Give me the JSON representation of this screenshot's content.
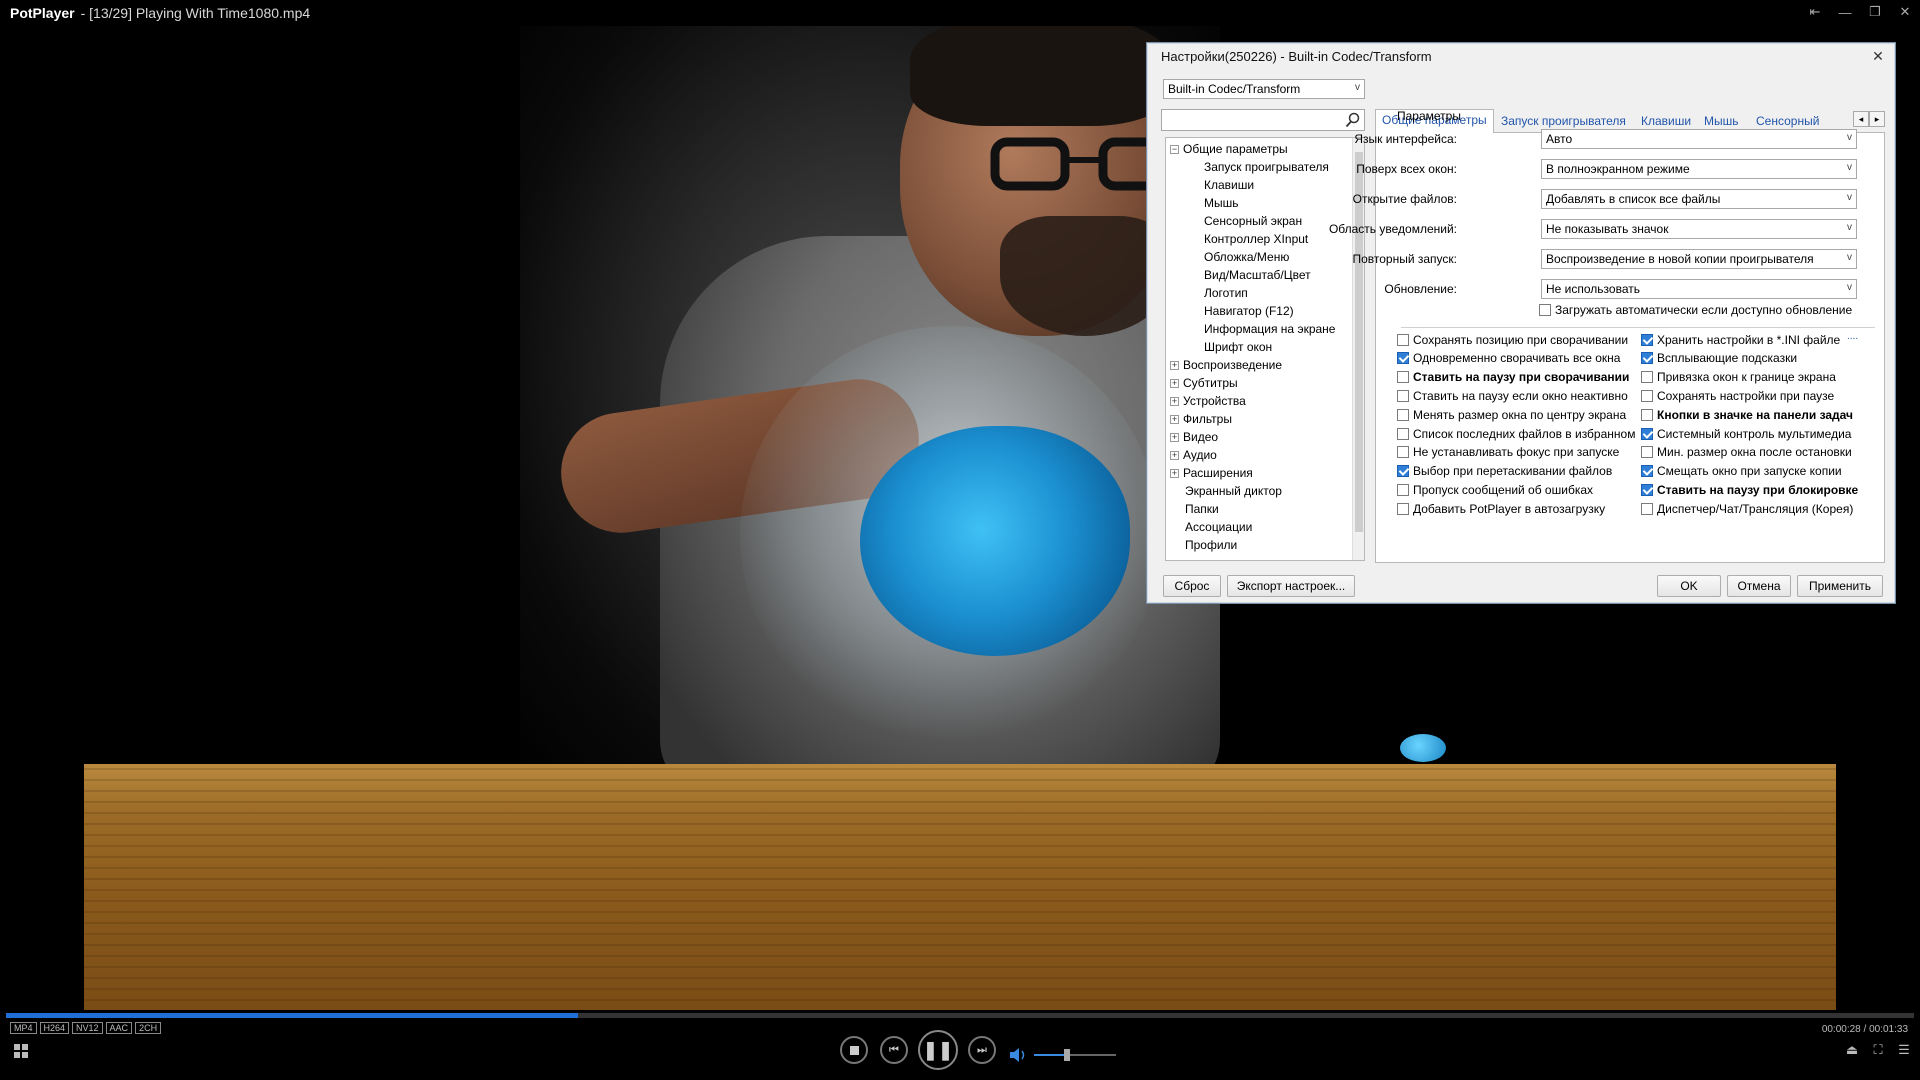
{
  "window": {
    "brand": "PotPlayer",
    "title": " - [13/29] Playing With Time1080.mp4"
  },
  "dialog": {
    "title": "Настройки(250226) - Built-in Codec/Transform",
    "profile_combo": "Built-in Codec/Transform",
    "search_placeholder": "",
    "tree": [
      {
        "label": "Общие параметры",
        "level": 0,
        "expander": "−"
      },
      {
        "label": "Запуск проигрывателя",
        "level": 1
      },
      {
        "label": "Клавиши",
        "level": 1
      },
      {
        "label": "Мышь",
        "level": 1
      },
      {
        "label": "Сенсорный экран",
        "level": 1
      },
      {
        "label": "Контроллер XInput",
        "level": 1
      },
      {
        "label": "Обложка/Меню",
        "level": 1
      },
      {
        "label": "Вид/Масштаб/Цвет",
        "level": 1
      },
      {
        "label": "Логотип",
        "level": 1
      },
      {
        "label": "Навигатор (F12)",
        "level": 1
      },
      {
        "label": "Информация на экране",
        "level": 1
      },
      {
        "label": "Шрифт окон",
        "level": 1
      },
      {
        "label": "Воспроизведение",
        "level": 0,
        "expander": "+"
      },
      {
        "label": "Субтитры",
        "level": 0,
        "expander": "+"
      },
      {
        "label": "Устройства",
        "level": 0,
        "expander": "+"
      },
      {
        "label": "Фильтры",
        "level": 0,
        "expander": "+"
      },
      {
        "label": "Видео",
        "level": 0,
        "expander": "+"
      },
      {
        "label": "Аудио",
        "level": 0,
        "expander": "+"
      },
      {
        "label": "Расширения",
        "level": 0,
        "expander": "+"
      },
      {
        "label": "Экранный диктор",
        "level": 0
      },
      {
        "label": "Папки",
        "level": 0
      },
      {
        "label": "Ассоциации",
        "level": 0
      },
      {
        "label": "Профили",
        "level": 0
      }
    ],
    "tabs": [
      "Общие параметры",
      "Запуск проигрывателя",
      "Клавиши",
      "Мышь",
      "Сенсорный"
    ],
    "group_label": "Параметры",
    "settings": [
      {
        "label": "Язык интерфейса:",
        "value": "Авто"
      },
      {
        "label": "Поверх всех окон:",
        "value": "В полноэкранном режиме"
      },
      {
        "label": "Открытие файлов:",
        "value": "Добавлять в список все файлы"
      },
      {
        "label": "Область уведомлений:",
        "value": "Не показывать значок"
      },
      {
        "label": "Повторный запуск:",
        "value": "Воспроизведение в новой копии проигрывателя"
      },
      {
        "label": "Обновление:",
        "value": "Не использовать"
      }
    ],
    "auto_update": {
      "label": "Загружать автоматически если доступно обновление",
      "checked": false
    },
    "checks_left": [
      {
        "label": "Сохранять позицию при сворачивании",
        "checked": false,
        "bold": false
      },
      {
        "label": "Одновременно сворачивать все окна",
        "checked": true,
        "bold": false
      },
      {
        "label": "Ставить на паузу при сворачивании",
        "checked": false,
        "bold": true
      },
      {
        "label": "Ставить на паузу если окно неактивно",
        "checked": false,
        "bold": false
      },
      {
        "label": "Менять размер окна по центру экрана",
        "checked": false,
        "bold": false
      },
      {
        "label": "Список последних файлов в избранном",
        "checked": false,
        "bold": false
      },
      {
        "label": "Не устанавливать фокус при запуске",
        "checked": false,
        "bold": false
      },
      {
        "label": "Выбор при перетаскивании файлов",
        "checked": true,
        "bold": false
      },
      {
        "label": "Пропуск сообщений об ошибках",
        "checked": false,
        "bold": false
      },
      {
        "label": "Добавить PotPlayer в автозагрузку",
        "checked": false,
        "bold": false
      }
    ],
    "checks_right": [
      {
        "label": "Хранить настройки в *.INI файле",
        "checked": true,
        "bold": false
      },
      {
        "label": "Всплывающие подсказки",
        "checked": true,
        "bold": false
      },
      {
        "label": "Привязка окон к границе экрана",
        "checked": false,
        "bold": false
      },
      {
        "label": "Сохранять настройки при паузе",
        "checked": false,
        "bold": false
      },
      {
        "label": "Кнопки в значке на панели задач",
        "checked": false,
        "bold": true
      },
      {
        "label": "Системный контроль мультимедиа",
        "checked": true,
        "bold": false
      },
      {
        "label": "Мин. размер окна после остановки",
        "checked": false,
        "bold": false
      },
      {
        "label": "Смещать окно при запуске копии",
        "checked": true,
        "bold": false
      },
      {
        "label": "Ставить на паузу при блокировке",
        "checked": true,
        "bold": true
      },
      {
        "label": "Диспетчер/Чат/Трансляция (Корея)",
        "checked": false,
        "bold": false
      }
    ],
    "ini_link": "....",
    "buttons": {
      "reset": "Сброс",
      "export": "Экспорт настроек...",
      "ok": "OK",
      "cancel": "Отмена",
      "apply": "Применить"
    }
  },
  "player": {
    "badges": [
      "MP4",
      "H264",
      "NV12",
      "AAC",
      "2CH"
    ],
    "time": "00:00:28 / 00:01:33",
    "progress_fraction": 0.3,
    "volume_fraction": 0.4
  }
}
